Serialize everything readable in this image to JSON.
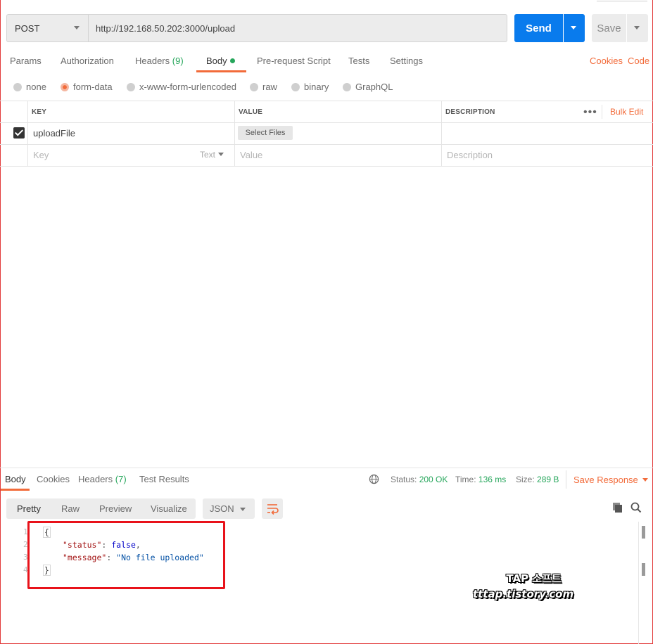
{
  "request": {
    "method": "POST",
    "url": "http://192.168.50.202:3000/upload",
    "send_label": "Send",
    "save_label": "Save"
  },
  "request_tabs": {
    "params": "Params",
    "authorization": "Authorization",
    "headers": "Headers",
    "headers_count": "(9)",
    "body": "Body",
    "pre_request": "Pre-request Script",
    "tests": "Tests",
    "settings": "Settings",
    "cookies": "Cookies",
    "code": "Code"
  },
  "body_types": {
    "none": "none",
    "form_data": "form-data",
    "urlencoded": "x-www-form-urlencoded",
    "raw": "raw",
    "binary": "binary",
    "graphql": "GraphQL",
    "selected": "form-data"
  },
  "table": {
    "headers": {
      "key": "KEY",
      "value": "VALUE",
      "description": "DESCRIPTION"
    },
    "bulk_edit": "Bulk Edit",
    "rows": [
      {
        "checked": true,
        "key": "uploadFile",
        "value_button": "Select Files",
        "description": ""
      }
    ],
    "new_row": {
      "key_placeholder": "Key",
      "type": "Text",
      "value_placeholder": "Value",
      "description_placeholder": "Description"
    }
  },
  "response_tabs": {
    "body": "Body",
    "cookies": "Cookies",
    "headers": "Headers",
    "headers_count": "(7)",
    "test_results": "Test Results"
  },
  "response_meta": {
    "status_label": "Status:",
    "status_value": "200 OK",
    "time_label": "Time:",
    "time_value": "136 ms",
    "size_label": "Size:",
    "size_value": "289 B",
    "save_response": "Save Response"
  },
  "view_modes": {
    "pretty": "Pretty",
    "raw": "Raw",
    "preview": "Preview",
    "visualize": "Visualize",
    "format": "JSON"
  },
  "response_body": {
    "line_numbers": [
      "1",
      "2",
      "3",
      "4"
    ],
    "open_brace": "{",
    "status_key": "\"status\"",
    "status_value": "false",
    "message_key": "\"message\"",
    "message_value": "\"No file uploaded\"",
    "close_brace": "}"
  },
  "watermark": {
    "line1": "TAP 소프트",
    "line2": "tttap.tistory.com"
  },
  "colors": {
    "accent": "#f26b3a",
    "send": "#097bed",
    "success": "#26a65b",
    "highlight_box": "#e8121a"
  }
}
